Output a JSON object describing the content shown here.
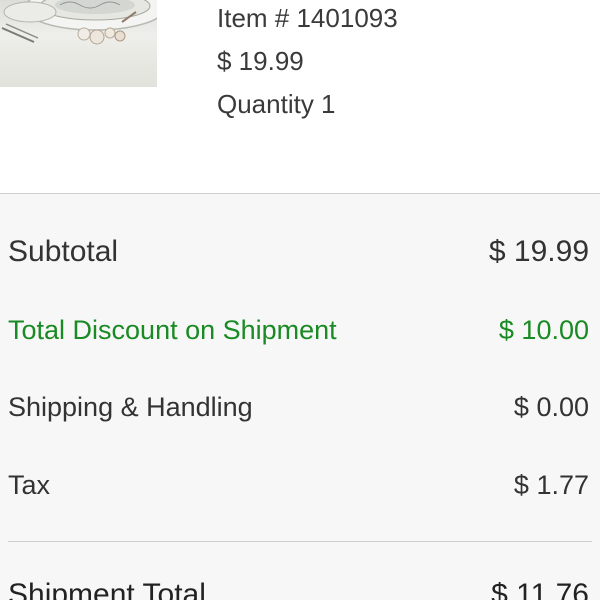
{
  "product": {
    "item_number": "Item # 1401093",
    "price": "$ 19.99",
    "quantity": "Quantity 1"
  },
  "totals": {
    "subtotal": {
      "label": "Subtotal",
      "value": "$ 19.99"
    },
    "discount": {
      "label": "Total Discount on Shipment",
      "value": "$ 10.00"
    },
    "shipping": {
      "label": "Shipping & Handling",
      "value": "$ 0.00"
    },
    "tax": {
      "label": "Tax",
      "value": "$ 1.77"
    },
    "shipment_total": {
      "label": "Shipment Total",
      "value": "$ 11.76"
    }
  },
  "colors": {
    "discount": "#1a8a24",
    "text": "#333333",
    "background": "#f7f7f7"
  }
}
